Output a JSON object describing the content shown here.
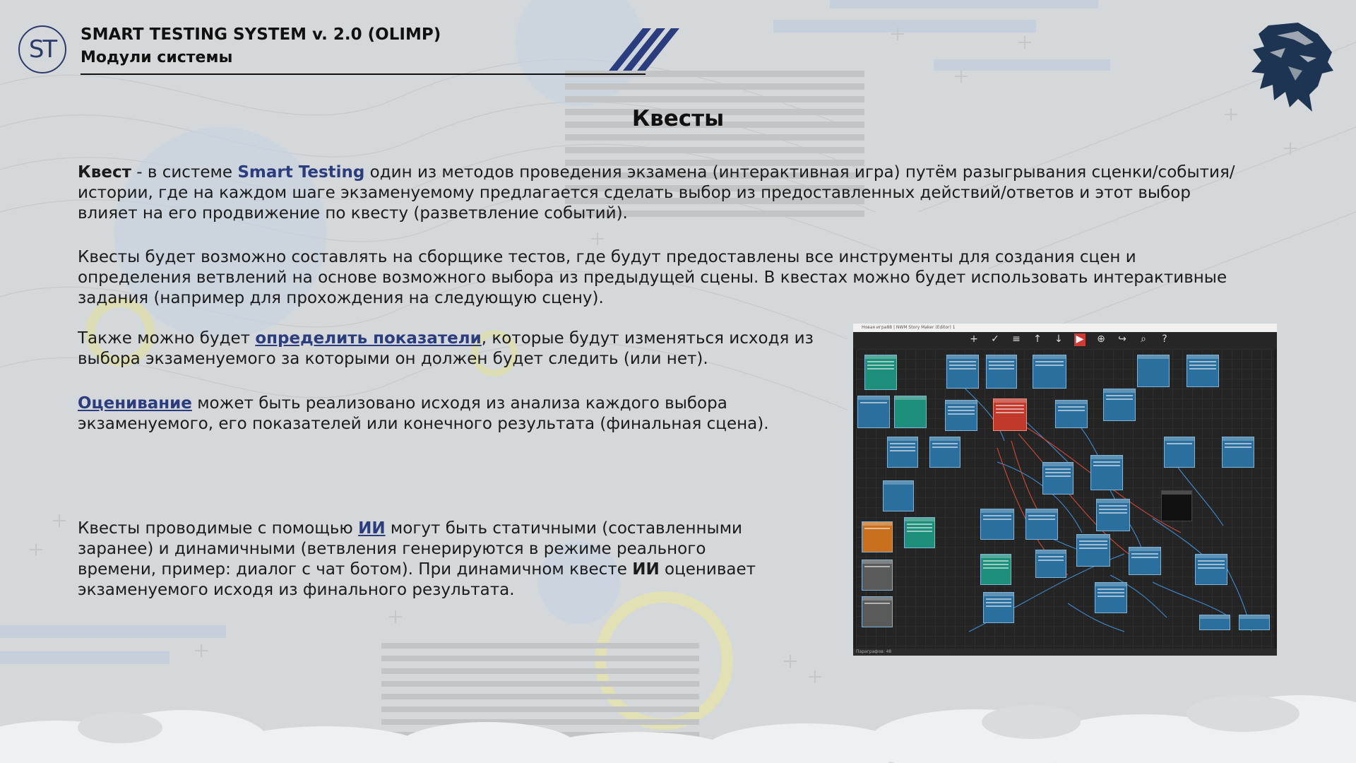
{
  "header": {
    "logo_text": "ST",
    "title": "SMART TESTING SYSTEM v. 2.0 (OLIMP)",
    "subtitle": "Модули системы"
  },
  "slide_title": "Квесты",
  "p1": {
    "term": "Квест",
    "part1": " - в системе ",
    "brand": "Smart Testing",
    "part2": " один из методов проведения экзамена (интерактивная игра) путём разыгрывания сценки/события/",
    "line2": "истории, где на каждом шаге экзаменуемому предлагается сделать выбор из предоставленных действий/ответов и этот выбор",
    "line3": "влияет на его продвижение по квесту (разветвление событий)."
  },
  "p2": {
    "line1": "Квесты будет возможно составлять на сборщике тестов, где будут предоставлены все инструменты для создания сцен и",
    "line2": "определения ветвлений на основе возможного выбора из предыдущей сцены. В квестах можно будет использовать интерактивные",
    "line3": "задания (например для прохождения на следующую сцену)."
  },
  "p3": {
    "part1": "Также можно будет ",
    "link": "определить показатели",
    "part2": ", которые будут изменяться исходя из",
    "line2": "выбора экзаменуемого за которыми он должен будет следить (или нет)."
  },
  "p4": {
    "link": "Оценивание",
    "part1": " может быть реализовано исходя из анализа каждого выбора",
    "line2": "экзаменуемого, его показателей или конечного результата (финальная сцена)."
  },
  "p5": {
    "part1": "Квесты проводимые с помощью ",
    "link": "ИИ",
    "part2": " могут быть статичными (составленными",
    "line2": "заранее) и динамичными (ветвления генерируются в режиме реального",
    "line3a": "времени, пример: диалог с чат ботом). При динамичном квесте ",
    "line3b": "ИИ",
    "line3c": " оценивает",
    "line4": "экзаменуемого исходя из финального результата."
  },
  "editor": {
    "window_title": "Новая игра88 | NWM Story Maker (Editor) 1",
    "status": "Параграфов: 48",
    "toolbar_icons": [
      "plus-icon",
      "check-icon",
      "list-icon",
      "arrow-up-icon",
      "arrow-down-icon",
      "play-icon",
      "add-circle-icon",
      "share-icon",
      "search-icon",
      "help-icon"
    ]
  },
  "colors": {
    "accent": "#2b3d7e",
    "node_blue": "#2a6f9e",
    "node_teal": "#1e8f7a",
    "node_red": "#c0392b",
    "node_orange": "#c8701e",
    "node_gray": "#5a5a5a"
  }
}
